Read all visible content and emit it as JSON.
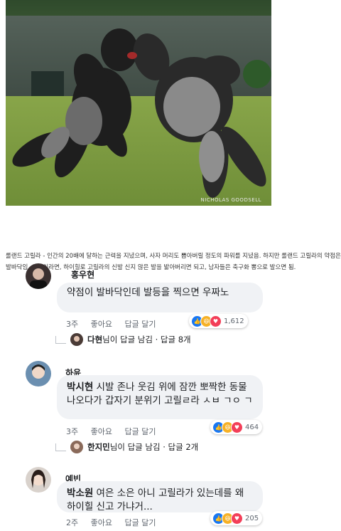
{
  "photo": {
    "credit": "NICHOLAS GOODSELL"
  },
  "caption": "롤랜드 고릴라 - 인간의 20배에 달하는 근력을 지녔으며, 사자 머리도 뽑아버릴 정도의 파워를 지녔음. 하지만 롤랜드 고릴라의 약점은 발바닥임. 여성이라면, 하이힐로 고릴라의 신발 신지 않은 발을 밟아버리면 되고, 남자들은 축구화 뽕으로 발으면 됨.",
  "comments": [
    {
      "name": "홍우현",
      "text": "약점이 발바닥인데 발등을 찍으면 우짜노",
      "time": "3주",
      "like": "좋아요",
      "reply": "답글 달기",
      "reaction_count": "1,612",
      "replies": {
        "replier": "다현",
        "text": "님이 답글 남김 · 답글 8개"
      }
    },
    {
      "name": "하윤",
      "tag": "박시현",
      "text": " 시발 존나 웃김 위에 잠깐 뽀짝한 동물 나오다가 갑자기 분위기 고릴ㄹ라 ㅅㅂ ㄱㅇ ㄱ",
      "time": "3주",
      "like": "좋아요",
      "reply": "답글 달기",
      "reaction_count": "464",
      "replies": {
        "replier": "한지민",
        "text": "님이 답글 남김 · 답글 2개"
      }
    },
    {
      "name": "예빈",
      "tag": "박소원",
      "text": " 여은 소은 아니 고릴라가 있는데를 왜 하이힐 신고 가냐거...",
      "time": "2주",
      "like": "좋아요",
      "reply": "답글 달기",
      "reaction_count": "205"
    }
  ],
  "colors": {
    "like": "#1877f2",
    "haha": "#f7b125",
    "love": "#f33e58"
  }
}
